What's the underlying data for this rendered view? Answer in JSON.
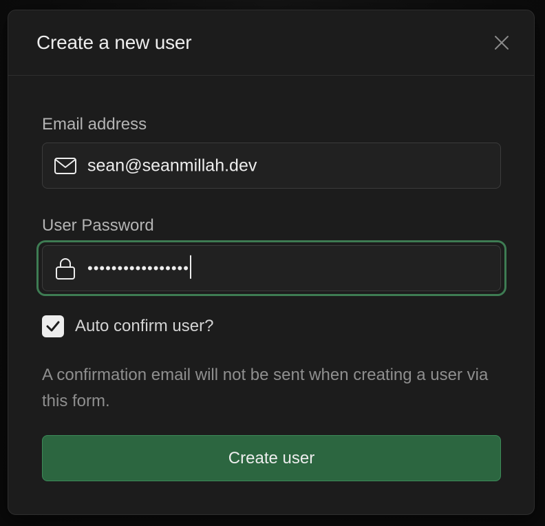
{
  "modal": {
    "title": "Create a new user",
    "close_icon": "close-icon"
  },
  "email": {
    "label": "Email address",
    "value": "sean@seanmillah.dev",
    "icon": "mail-icon"
  },
  "password": {
    "label": "User Password",
    "masked_value": "•••••••••••••••••",
    "icon": "lock-icon"
  },
  "auto_confirm": {
    "label": "Auto confirm user?",
    "checked": true
  },
  "helper_text": "A confirmation email will not be sent when creating a user via this form.",
  "submit": {
    "label": "Create user"
  },
  "colors": {
    "accent": "#2c6640",
    "focus_ring": "#3e7c53",
    "surface": "#1c1c1c"
  }
}
